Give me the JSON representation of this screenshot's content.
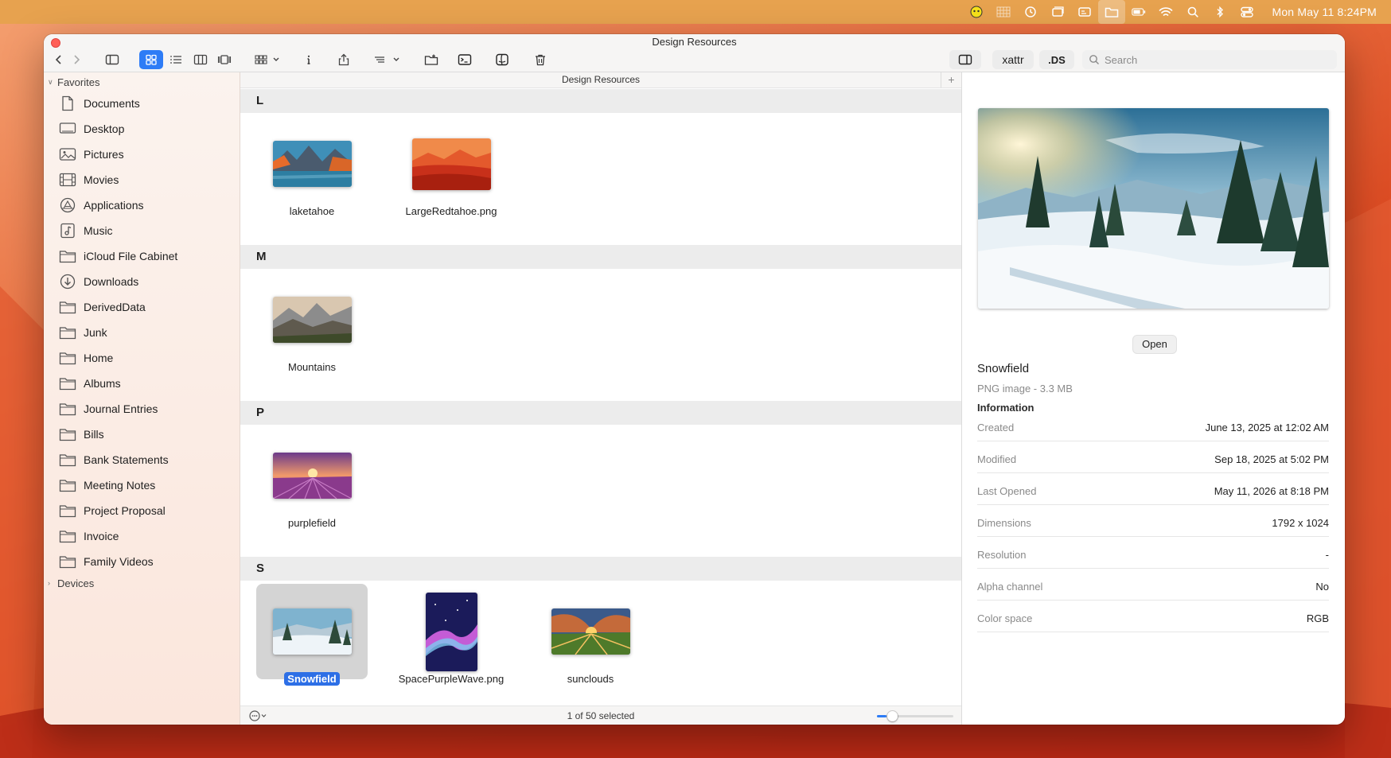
{
  "menubar": {
    "clock": "Mon May 11  8:24PM",
    "icons": [
      "alien-icon",
      "grid-icon",
      "history-icon",
      "window-icon",
      "card-icon",
      "folder-icon",
      "battery-icon",
      "wifi-icon",
      "search-icon",
      "bluetooth-icon",
      "control-center-icon"
    ]
  },
  "window": {
    "title": "Design Resources",
    "toolbar": {
      "xattr_label": "xattr",
      "ds_label": ".DS",
      "search_placeholder": "Search"
    }
  },
  "sidebar": {
    "favorites_label": "Favorites",
    "devices_label": "Devices",
    "items": [
      {
        "label": "Documents",
        "icon": "document-icon"
      },
      {
        "label": "Desktop",
        "icon": "desktop-icon"
      },
      {
        "label": "Pictures",
        "icon": "photo-icon"
      },
      {
        "label": "Movies",
        "icon": "film-icon"
      },
      {
        "label": "Applications",
        "icon": "applications-icon"
      },
      {
        "label": "Music",
        "icon": "music-icon"
      },
      {
        "label": "iCloud File Cabinet",
        "icon": "folder-icon"
      },
      {
        "label": "Downloads",
        "icon": "download-icon"
      },
      {
        "label": "DerivedData",
        "icon": "folder-icon"
      },
      {
        "label": "Junk",
        "icon": "folder-icon"
      },
      {
        "label": "Home",
        "icon": "folder-icon"
      },
      {
        "label": "Albums",
        "icon": "folder-icon"
      },
      {
        "label": "Journal Entries",
        "icon": "folder-icon"
      },
      {
        "label": "Bills",
        "icon": "folder-icon"
      },
      {
        "label": "Bank Statements",
        "icon": "folder-icon"
      },
      {
        "label": "Meeting Notes",
        "icon": "folder-icon"
      },
      {
        "label": "Project Proposal",
        "icon": "folder-icon"
      },
      {
        "label": "Invoice",
        "icon": "folder-icon"
      },
      {
        "label": "Family Videos",
        "icon": "folder-icon"
      }
    ]
  },
  "pathbar": {
    "title": "Design Resources",
    "add_label": "+"
  },
  "groups": [
    {
      "letter": "L",
      "files": [
        {
          "name": "laketahoe"
        },
        {
          "name": "LargeRedtahoe.png"
        }
      ]
    },
    {
      "letter": "M",
      "files": [
        {
          "name": "Mountains"
        }
      ]
    },
    {
      "letter": "P",
      "files": [
        {
          "name": "purplefield"
        }
      ]
    },
    {
      "letter": "S",
      "files": [
        {
          "name": "Snowfield",
          "selected": true
        },
        {
          "name": "SpacePurpleWave.png"
        },
        {
          "name": "sunclouds"
        }
      ]
    }
  ],
  "status": {
    "text": "1 of 50 selected",
    "zoom_fraction": 0.12
  },
  "preview": {
    "open_label": "Open",
    "name": "Snowfield",
    "kind": "PNG image - 3.3 MB",
    "info_heading": "Information",
    "rows": [
      {
        "key": "Created",
        "value": "June 13, 2025 at 12:02 AM"
      },
      {
        "key": "Modified",
        "value": "Sep 18, 2025 at 5:02 PM"
      },
      {
        "key": "Last Opened",
        "value": "May 11, 2026 at 8:18 PM"
      },
      {
        "key": "Dimensions",
        "value": "1792 x 1024"
      },
      {
        "key": "Resolution",
        "value": "-"
      },
      {
        "key": "Alpha channel",
        "value": "No"
      },
      {
        "key": "Color space",
        "value": "RGB"
      }
    ]
  },
  "colors": {
    "accent": "#2d7cf6",
    "menubar": "#e7a24f",
    "close_button": "#ff5f57"
  }
}
